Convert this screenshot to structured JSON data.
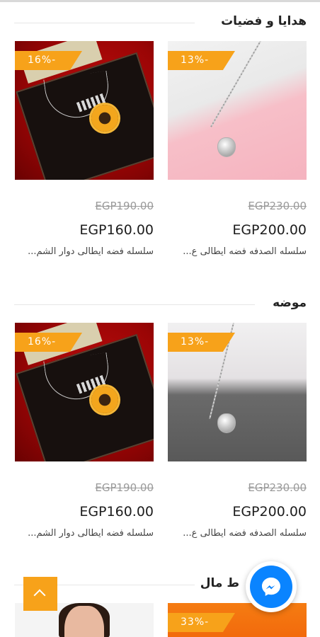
{
  "sections": [
    {
      "title": "هدايا و فضيات",
      "products": [
        {
          "name": "سلسله الصدفه فضه ايطالى ع...",
          "price": "EGP200.00",
          "old_price": "EGP230.00",
          "discount": "13%-",
          "image": "pearl-necklace-pink"
        },
        {
          "name": "سلسله فضه ايطالى دوار الشم...",
          "price": "EGP160.00",
          "old_price": "EGP190.00",
          "discount": "16%-",
          "image": "sunflower-necklace-red"
        }
      ]
    },
    {
      "title": "موضه",
      "products": [
        {
          "name": "سلسله الصدفه فضه ايطالى ع...",
          "price": "EGP200.00",
          "old_price": "EGP230.00",
          "discount": "13%-",
          "image": "pearl-necklace-grey"
        },
        {
          "name": "سلسله فضه ايطالى دوار الشم...",
          "price": "EGP160.00",
          "old_price": "EGP190.00",
          "discount": "16%-",
          "image": "sunflower-necklace-red"
        }
      ]
    },
    {
      "title": "جمال",
      "title_visible": "ط     مال",
      "products": [
        {
          "discount": "33%-",
          "image": "orange-product"
        },
        {
          "image": "woman-portrait"
        }
      ]
    }
  ],
  "colors": {
    "accent": "#f7a21a",
    "messenger": "#0a84ff"
  },
  "icons": {
    "scroll_top": "chevron-up-icon",
    "chat": "messenger-icon"
  }
}
